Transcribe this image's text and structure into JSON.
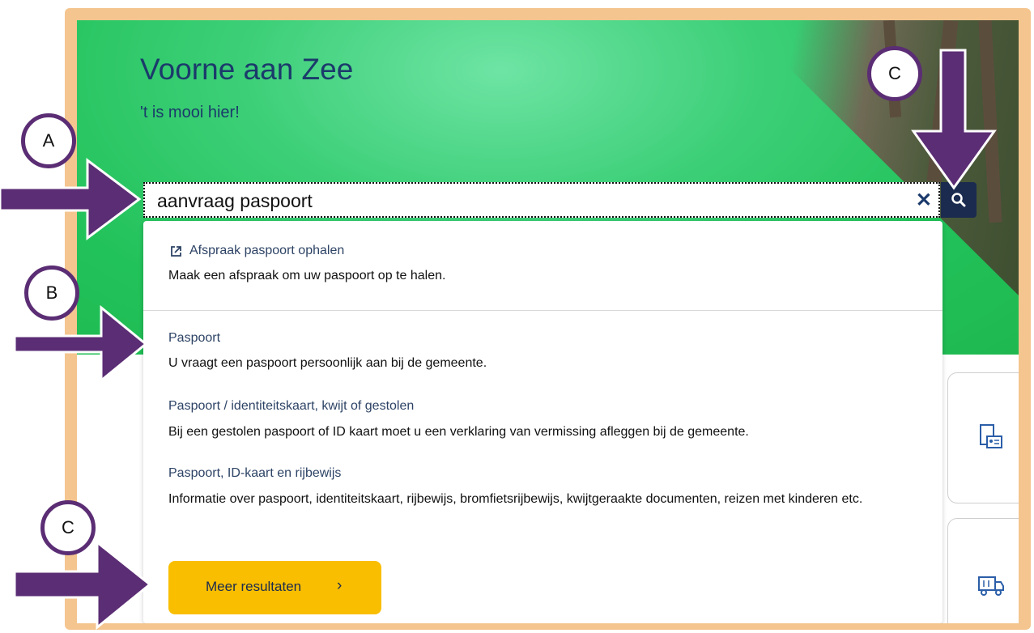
{
  "site": {
    "title": "Voorne aan Zee",
    "tagline": "'t is mooi hier!"
  },
  "search": {
    "value": "aanvraag paspoort",
    "clear_icon": "close-icon",
    "submit_icon": "search-icon"
  },
  "results": {
    "featured": {
      "title": "Afspraak paspoort ophalen",
      "icon": "external-link-icon",
      "description": "Maak een afspraak om uw paspoort op te halen."
    },
    "items": [
      {
        "title": "Paspoort",
        "description": "U vraagt een paspoort persoonlijk aan bij de gemeente."
      },
      {
        "title": "Paspoort / identiteitskaart, kwijt of gestolen",
        "description": "Bij een gestolen paspoort of ID kaart moet u een verklaring van vermissing afleggen bij de gemeente."
      },
      {
        "title": "Paspoort, ID-kaart en rijbewijs",
        "description": "Informatie over paspoort, identiteitskaart, rijbewijs, bromfietsrijbewijs, kwijtgeraakte documenten, reizen met kinderen etc."
      }
    ],
    "more_button": "Meer resultaten",
    "more_icon": "chevron-right-icon"
  },
  "annotations": {
    "A": "A",
    "B": "B",
    "C_top": "C",
    "C_bottom": "C",
    "arrow_color": "#5b2d74"
  },
  "colors": {
    "frame": "#f4c58f",
    "hero_green": "#22c25a",
    "brand_navy": "#1b2b4f",
    "button_yellow": "#f9be00"
  }
}
